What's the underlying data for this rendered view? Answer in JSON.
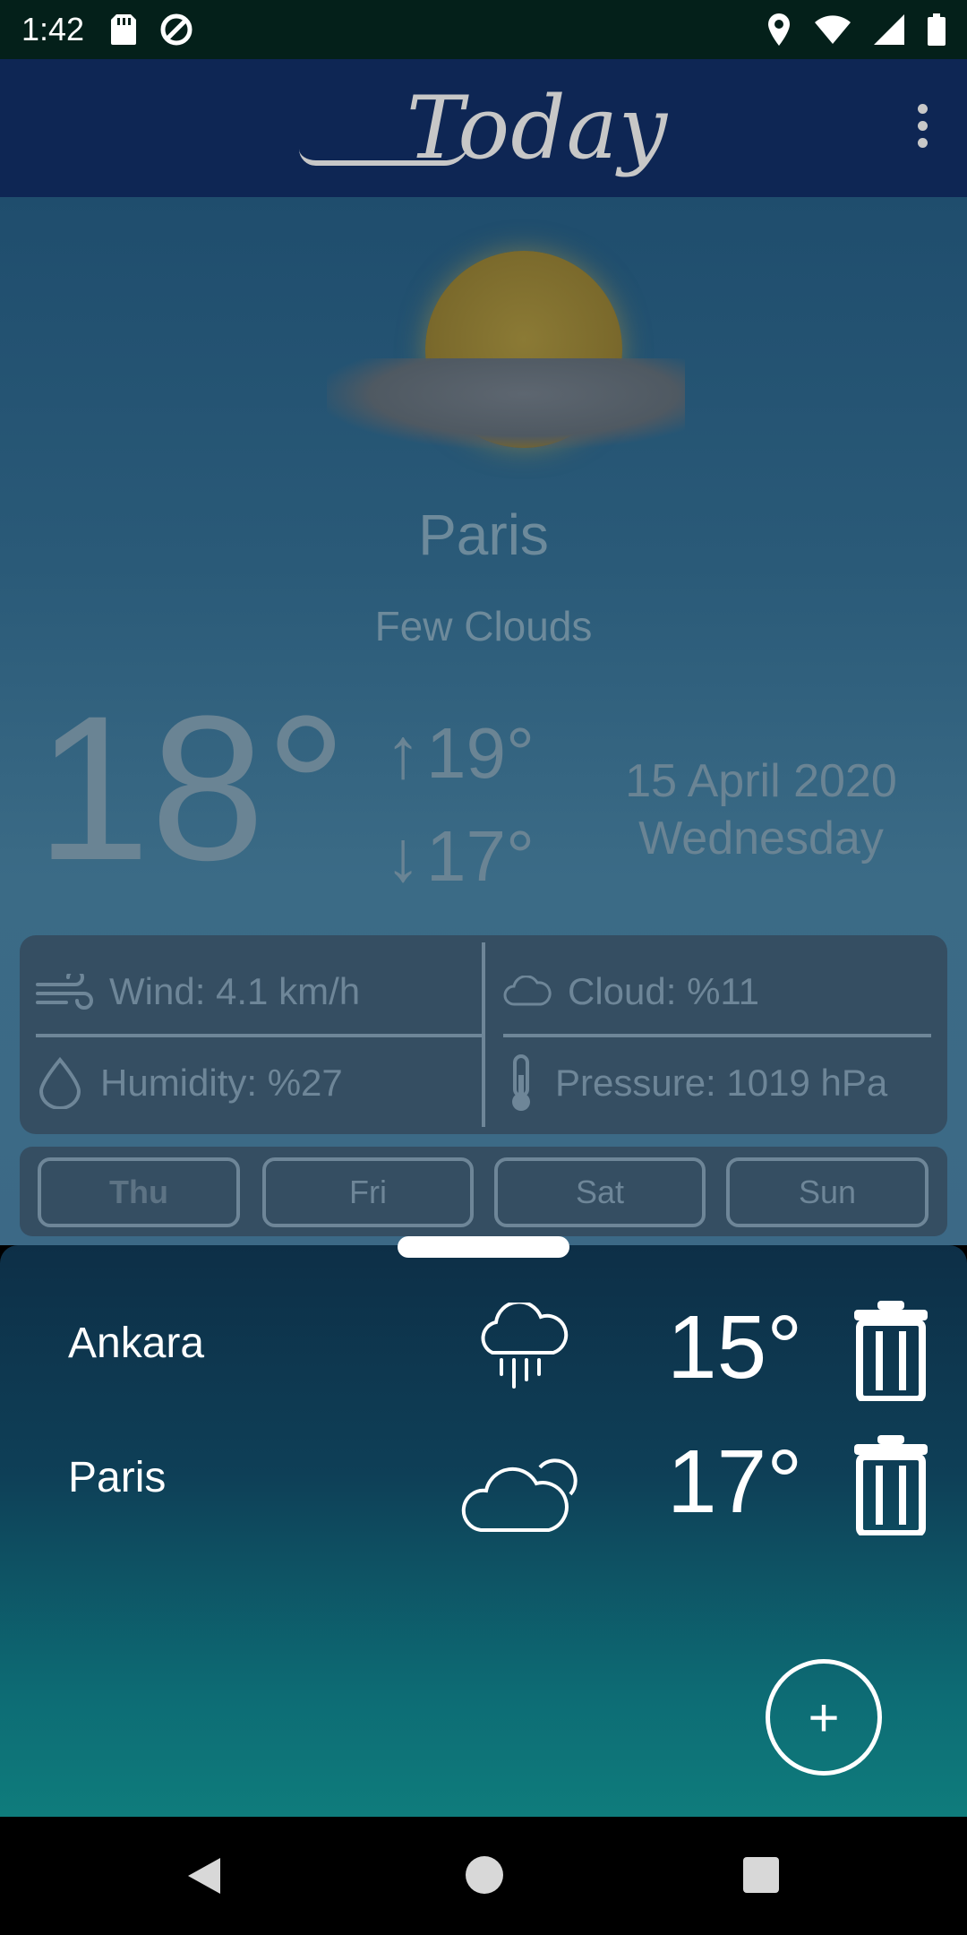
{
  "status_bar": {
    "time": "1:42"
  },
  "app_bar": {
    "logo_text": "Today"
  },
  "current": {
    "city": "Paris",
    "condition": "Few Clouds",
    "temp": "18°",
    "high": "19°",
    "low": "17°",
    "date": "15 April 2020",
    "weekday": "Wednesday"
  },
  "details": {
    "wind": "Wind: 4.1 km/h",
    "cloud": "Cloud:  %11",
    "humidity": "Humidity:  %27",
    "pressure": "Pressure: 1019 hPa"
  },
  "days": [
    "Thu",
    "Fri",
    "Sat",
    "Sun"
  ],
  "saved_cities": [
    {
      "name": "Ankara",
      "temp": "15°",
      "icon": "rain-cloud-icon"
    },
    {
      "name": "Paris",
      "temp": "17°",
      "icon": "cloudy-sun-icon"
    }
  ],
  "fab": {
    "label": "+"
  },
  "colors": {
    "status_bar": "#04201a",
    "app_bar": "#0e2654",
    "sheet_top": "#0d2f47",
    "sheet_bottom": "#0f7c7c"
  }
}
